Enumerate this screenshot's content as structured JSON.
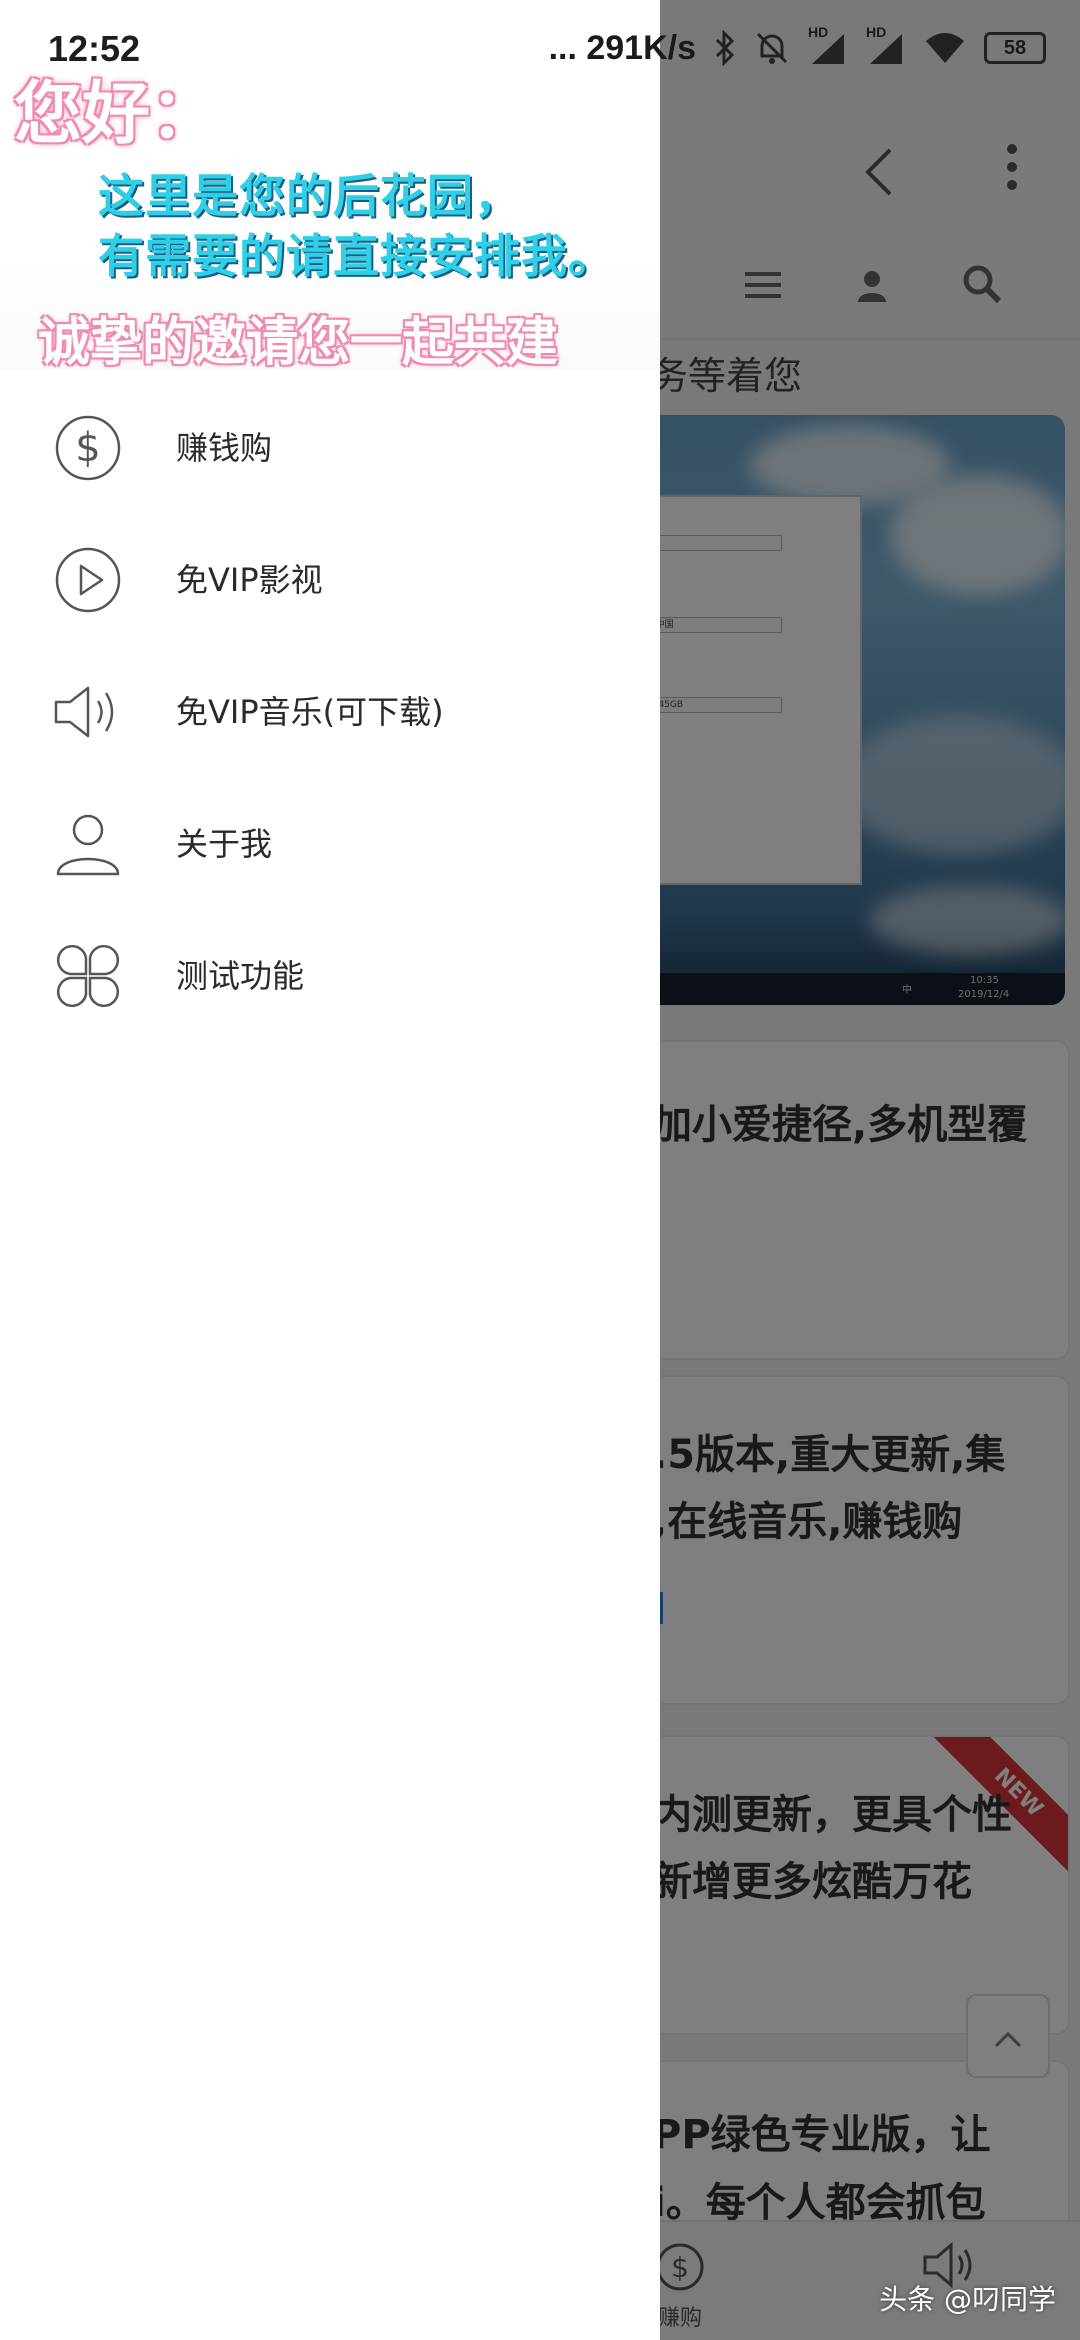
{
  "status_bar": {
    "time": "12:52",
    "net_speed": "... 291K/s",
    "signal1_label": "HD",
    "signal2_label": "HD",
    "battery": "58"
  },
  "drawer": {
    "greeting": {
      "hello": "您好：",
      "line1": "这里是您的后花园，",
      "line2": "有需要的请直接安排我。",
      "line3": "诚挚的邀请您一起共建"
    },
    "menu_items": [
      {
        "label": "赚钱购",
        "icon": "dollar-circle-icon"
      },
      {
        "label": "免VIP影视",
        "icon": "play-circle-icon"
      },
      {
        "label": "免VIP音乐(可下载)",
        "icon": "speaker-icon"
      },
      {
        "label": "关于我",
        "icon": "user-icon"
      },
      {
        "label": "测试功能",
        "icon": "clover-icon"
      }
    ]
  },
  "background_page": {
    "notice_text": "务等着您",
    "cards": [
      {
        "lines": [
          "加小爱捷径,多机型覆"
        ],
        "link": "",
        "badge": ""
      },
      {
        "lines": [
          ".5版本,重大更新,集",
          ",在线音乐,赚钱购"
        ],
        "link": "]",
        "badge": ""
      },
      {
        "lines": [
          "内测更新，更具个性",
          "新增更多炫酷万花"
        ],
        "link": "",
        "badge": "NEW"
      },
      {
        "lines": [
          "PP绿色专业版，让",
          "i。每个人都会抓包"
        ],
        "link": "",
        "badge": ""
      }
    ],
    "hero_window_fields": [
      "...",
      "...中国",
      "... 45GB"
    ],
    "hero_taskbar": {
      "clock_time": "10:35",
      "clock_date": "2019/12/4",
      "lang": "中"
    },
    "scroll_top_icon": "chevron-up-icon",
    "bottom_nav": [
      {
        "label": "赚购",
        "icon": "dollar-circle-icon"
      },
      {
        "label": "",
        "icon": "speaker-icon"
      }
    ]
  },
  "watermark": "头条 @叼同学",
  "colors": {
    "accent_pink": "#f08ab0",
    "accent_cyan": "#2fd0e6",
    "new_badge": "#d9343a"
  }
}
